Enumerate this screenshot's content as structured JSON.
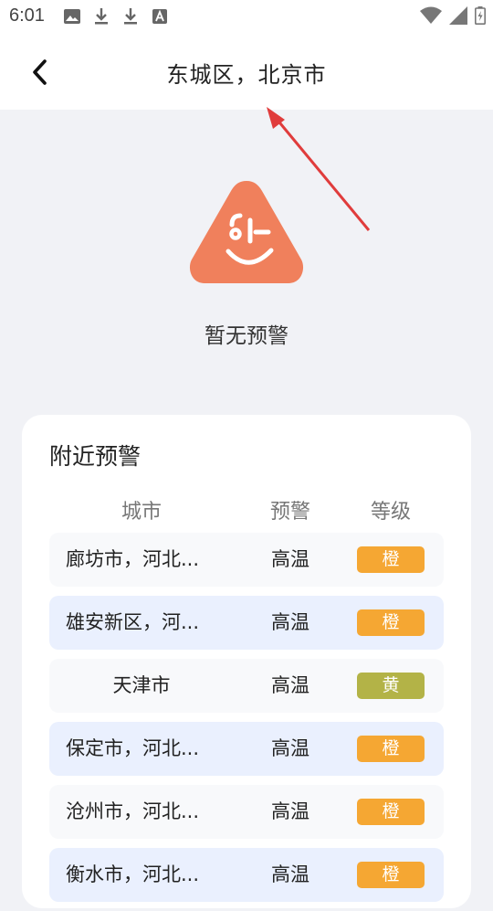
{
  "status_bar": {
    "time": "6:01",
    "left_icons": [
      "image-icon",
      "download-icon",
      "download-icon",
      "font-icon"
    ],
    "right_icons": [
      "wifi-icon",
      "signal-icon",
      "battery-icon"
    ]
  },
  "header": {
    "title": "东城区，北京市",
    "back_icon": "chevron-left-icon"
  },
  "empty_state": {
    "mascot_icon": "smile-triangle-icon",
    "text": "暂无预警",
    "color": "#f0805c"
  },
  "nearby": {
    "title": "附近预警",
    "columns": {
      "city": "城市",
      "warning": "预警",
      "level": "等级"
    },
    "rows": [
      {
        "city": "廊坊市，河北...",
        "warning": "高温",
        "level": "橙",
        "color": "#f5a733"
      },
      {
        "city": "雄安新区，河...",
        "warning": "高温",
        "level": "橙",
        "color": "#f5a733"
      },
      {
        "city": "天津市",
        "warning": "高温",
        "level": "黄",
        "color": "#b3b347"
      },
      {
        "city": "保定市，河北...",
        "warning": "高温",
        "level": "橙",
        "color": "#f5a733"
      },
      {
        "city": "沧州市，河北...",
        "warning": "高温",
        "level": "橙",
        "color": "#f5a733"
      },
      {
        "city": "衡水市，河北...",
        "warning": "高温",
        "level": "橙",
        "color": "#f5a733"
      }
    ]
  }
}
